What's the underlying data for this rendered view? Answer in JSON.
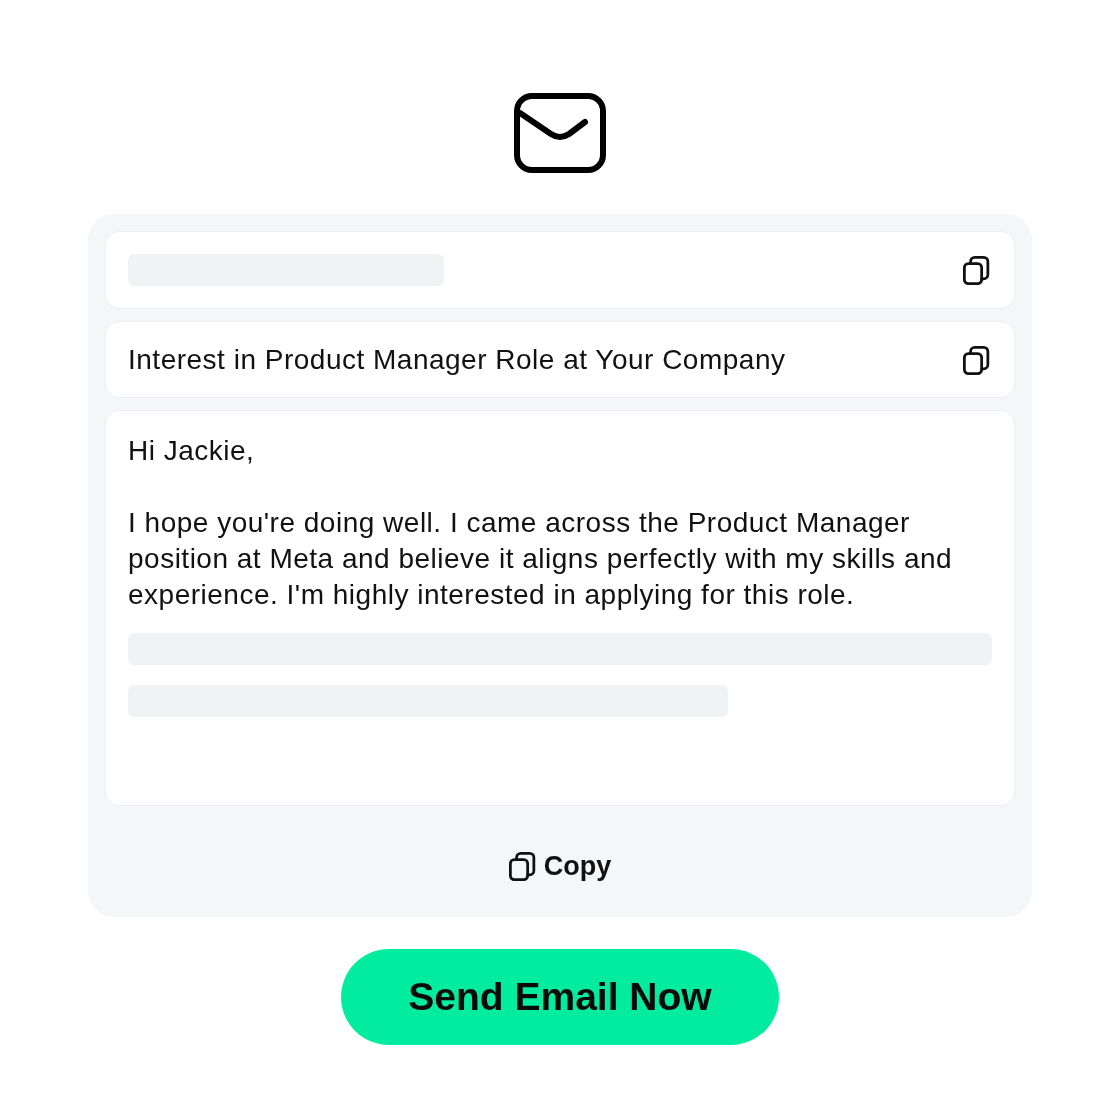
{
  "email": {
    "recipient": {
      "loading": true
    },
    "subject": {
      "text": "Interest in Product Manager Role at Your Company"
    },
    "body": {
      "paragraphs": [
        "Hi Jackie,",
        "I hope you're doing well. I came across the Product Manager position at Meta and believe it aligns perfectly with my skills and experience. I'm highly interested in applying for this role."
      ],
      "loading": true
    },
    "copy_button": {
      "label": "Copy"
    }
  },
  "send_button": {
    "label": "Send Email Now"
  }
}
